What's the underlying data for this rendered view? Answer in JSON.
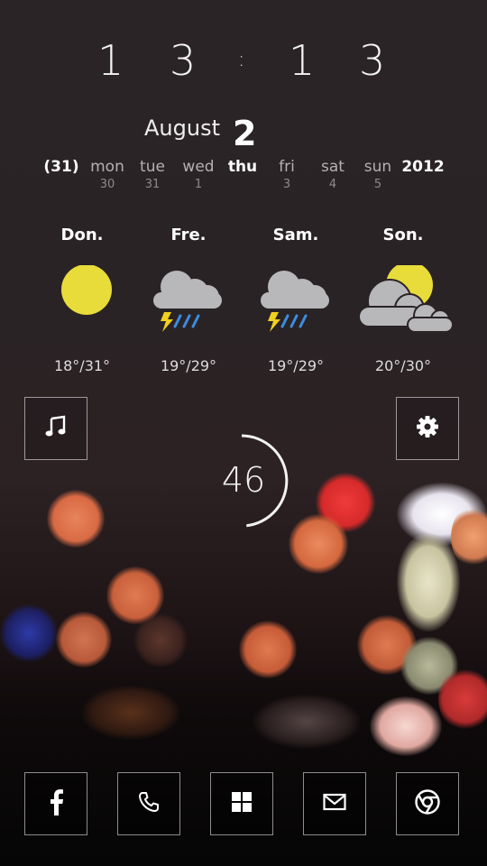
{
  "clock": {
    "h1": "1",
    "h2": "3",
    "sep": ":",
    "m1": "1",
    "m2": "3"
  },
  "date": {
    "month": "August",
    "day": "2"
  },
  "week": [
    {
      "name": "(31)",
      "num": "",
      "bold": true
    },
    {
      "name": "mon",
      "num": "30",
      "bold": false
    },
    {
      "name": "tue",
      "num": "31",
      "bold": false
    },
    {
      "name": "wed",
      "num": "1",
      "bold": false
    },
    {
      "name": "thu",
      "num": "",
      "bold": true
    },
    {
      "name": "fri",
      "num": "3",
      "bold": false
    },
    {
      "name": "sat",
      "num": "4",
      "bold": false
    },
    {
      "name": "sun",
      "num": "5",
      "bold": false
    },
    {
      "name": "2012",
      "num": "",
      "bold": true
    }
  ],
  "forecast": [
    {
      "day": "Don.",
      "icon": "sun-icon",
      "temp": "18°/31°"
    },
    {
      "day": "Fre.",
      "icon": "thunder-rain-icon",
      "temp": "19°/29°"
    },
    {
      "day": "Sam.",
      "icon": "thunder-rain-icon",
      "temp": "19°/29°"
    },
    {
      "day": "Son.",
      "icon": "partly-cloudy-icon",
      "temp": "20°/30°"
    }
  ],
  "battery": {
    "value": "46",
    "level": 0.46
  },
  "colors": {
    "sun": "#e8dc3a",
    "cloud": "#b8b8ba",
    "rain": "#3b8de0",
    "bolt": "#f0d020"
  },
  "dock": [
    "facebook-icon",
    "phone-icon",
    "windows-icon",
    "mail-icon",
    "chrome-icon"
  ],
  "tiles": [
    "music-note-icon",
    "gear-icon"
  ]
}
